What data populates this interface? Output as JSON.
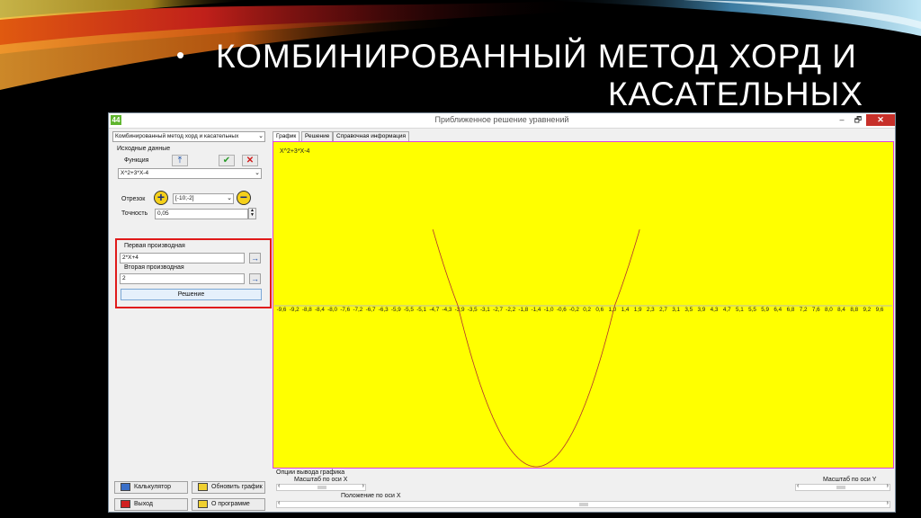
{
  "slide": {
    "bullet": "•",
    "title_line1": "КОМБИНИРОВАННЫЙ МЕТОД ХОРД И",
    "title_line2": "КАСАТЕЛЬНЫХ"
  },
  "window": {
    "title": "Приближенное решение уравнений",
    "icon_text": "44",
    "minimize": "–",
    "maximize": "🗗",
    "close": "✕"
  },
  "left_panel": {
    "method_select": "Комбинированный метод хорд и касательных",
    "source_data_label": "Исходные данные",
    "function_label": "Функция",
    "function_value": "X^2+3*X-4",
    "segment_label": "Отрезок",
    "segment_value": "[-10;-2]",
    "accuracy_label": "Точность",
    "accuracy_value": "0,05",
    "first_deriv_label": "Первая производная",
    "first_deriv_value": "2*X+4",
    "second_deriv_label": "Вторая производная",
    "second_deriv_value": "2",
    "solve_button": "Решение",
    "calculator_button": "Калькулятор",
    "refresh_button": "Обновить график",
    "exit_button": "Выход",
    "about_button": "О программе"
  },
  "tabs": [
    "График",
    "Решение",
    "Справочная информация"
  ],
  "graph": {
    "function_label": "X^2+3*X-4",
    "background": "#ffff00",
    "frame_color": "#e040e0",
    "curve_color": "#b03030",
    "x_ticks": [
      "-9,6",
      "-9,2",
      "-8,8",
      "-8,4",
      "-8,0",
      "-7,6",
      "-7,2",
      "-6,7",
      "-6,3",
      "-5,9",
      "-5,5",
      "-5,1",
      "-4,7",
      "-4,3",
      "-3,9",
      "-3,5",
      "-3,1",
      "-2,7",
      "-2,2",
      "-1,8",
      "-1,4",
      "-1,0",
      "-0,6",
      "-0,2",
      "0,2",
      "0,6",
      "1,0",
      "1,4",
      "1,9",
      "2,3",
      "2,7",
      "3,1",
      "3,5",
      "3,9",
      "4,3",
      "4,7",
      "5,1",
      "5,5",
      "5,9",
      "6,4",
      "6,8",
      "7,2",
      "7,6",
      "8,0",
      "8,4",
      "8,8",
      "9,2",
      "9,6"
    ]
  },
  "chart_data": {
    "type": "line",
    "series": [
      {
        "name": "X^2+3*X-4",
        "expression": "x^2+3x-4"
      }
    ],
    "xlim": [
      -9.8,
      9.8
    ],
    "ylim": [
      -6.25,
      10
    ],
    "x_tick_labels": [
      "-9,6",
      "-9,2",
      "-8,8",
      "-8,4",
      "-8,0",
      "-7,6",
      "-7,2",
      "-6,7",
      "-6,3",
      "-5,9",
      "-5,5",
      "-5,1",
      "-4,7",
      "-4,3",
      "-3,9",
      "-3,5",
      "-3,1",
      "-2,7",
      "-2,2",
      "-1,8",
      "-1,4",
      "-1,0",
      "-0,6",
      "-0,2",
      "0,2",
      "0,6",
      "1,0",
      "1,4",
      "1,9",
      "2,3",
      "2,7",
      "3,1",
      "3,5",
      "3,9",
      "4,3",
      "4,7",
      "5,1",
      "5,5",
      "5,9",
      "6,4",
      "6,8",
      "7,2",
      "7,6",
      "8,0",
      "8,4",
      "8,8",
      "9,2",
      "9,6"
    ],
    "grid": false
  },
  "options": {
    "title": "Опции вывода графика",
    "scale_x_label": "Масштаб по оси X",
    "scale_y_label": "Масштаб по оси Y",
    "pos_x_label": "Положение по оси X"
  }
}
